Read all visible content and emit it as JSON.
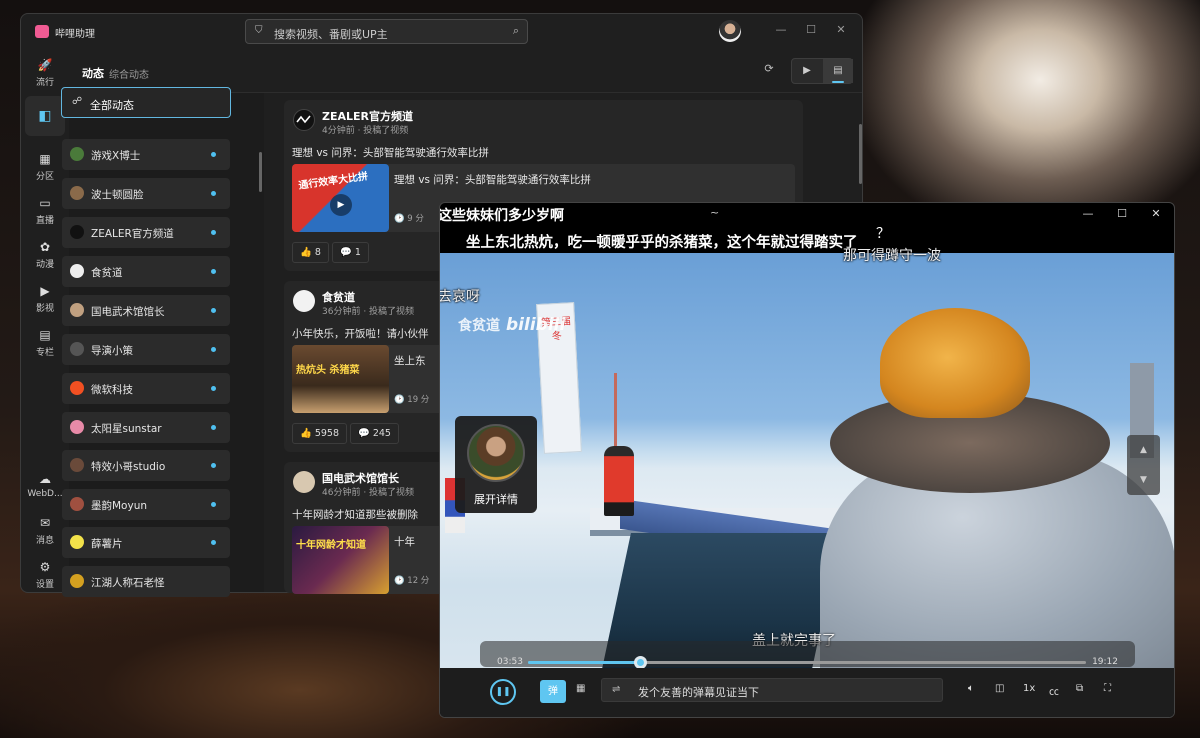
{
  "app": {
    "title": "哔哩助理"
  },
  "search": {
    "placeholder": "搜索视频、番剧或UP主"
  },
  "window_controls": {
    "minimize": "—",
    "maximize": "☐",
    "close": "✕"
  },
  "rail": [
    {
      "label": "流行",
      "icon": "rocket-icon",
      "glyph": "🚀"
    },
    {
      "label": "",
      "icon": "dynamic-icon",
      "glyph": "◧"
    },
    {
      "label": "分区",
      "icon": "grid-icon",
      "glyph": "▦"
    },
    {
      "label": "直播",
      "icon": "camera-icon",
      "glyph": "▭"
    },
    {
      "label": "动漫",
      "icon": "anime-icon",
      "glyph": "✿"
    },
    {
      "label": "影视",
      "icon": "film-icon",
      "glyph": "▶"
    },
    {
      "label": "专栏",
      "icon": "article-icon",
      "glyph": "▤"
    },
    {
      "label": "WebD...",
      "icon": "cloud-icon",
      "glyph": "☁"
    },
    {
      "label": "消息",
      "icon": "mail-icon",
      "glyph": "✉"
    },
    {
      "label": "设置",
      "icon": "gear-icon",
      "glyph": "⚙"
    }
  ],
  "header": {
    "title": "动态",
    "subtitle": "综合动态"
  },
  "user_list": {
    "all": "全部动态",
    "items": [
      {
        "name": "游戏X博士",
        "color": "#4a7a3a"
      },
      {
        "name": "波士顿圆脸",
        "color": "#8a6a4a"
      },
      {
        "name": "ZEALER官方频道",
        "color": "#111111"
      },
      {
        "name": "食贫道",
        "color": "#eeeeee"
      },
      {
        "name": "国电武术馆馆长",
        "color": "#c0a080"
      },
      {
        "name": "导演小策",
        "color": "#555555"
      },
      {
        "name": "微软科技",
        "color": "#f25022"
      },
      {
        "name": "太阳星sunstar",
        "color": "#e88aa8"
      },
      {
        "name": "特效小哥studio",
        "color": "#6a4a3a"
      },
      {
        "name": "墨韵Moyun",
        "color": "#a05040"
      },
      {
        "name": "薛薯片",
        "color": "#f3e24a"
      },
      {
        "name": "江湖人称石老怪",
        "color": "#d4a020"
      }
    ]
  },
  "feed": [
    {
      "author": "ZEALER官方频道",
      "meta": "4分钟前 · 投稿了视频",
      "text": "理想 vs 问界：头部智能驾驶通行效率比拼",
      "video_title": "理想 vs 问界：头部智能驾驶通行效率比拼",
      "video_info": "🕑 9 分",
      "likes": "👍 8",
      "comments": "💬 1",
      "thumb_text": "通行效率大比拼"
    },
    {
      "author": "食贫道",
      "meta": "36分钟前 · 投稿了视频",
      "text": "小年快乐，开饭啦！请小伙伴",
      "video_title": "坐上东",
      "video_info": "🕑 19 分",
      "likes": "👍 5958",
      "comments": "💬 245",
      "thumb_text": "热炕头 杀猪菜"
    },
    {
      "author": "国电武术馆馆长",
      "meta": "46分钟前 · 投稿了视频",
      "text": "十年网龄才知道那些被删除",
      "video_title": "十年",
      "video_info": "🕑 12 分",
      "thumb_text": "十年网龄才知道"
    }
  ],
  "player": {
    "title_bar": "~",
    "video_title": "坐上东北热炕，吃一顿暖乎乎的杀猪菜，这个年就过得踏实了",
    "watermark_left": "食贫道",
    "watermark_right": "bilibili",
    "danmaku": [
      "这些妹妹们多少岁啊",
      "？",
      "那可得蹲守一波",
      "去哀呀",
      "盖上就完事了"
    ],
    "current_time": "03:53",
    "total_time": "19:12",
    "progress": 0.2,
    "danmaku_toggle": "弹",
    "danmaku_placeholder": "发个友善的弹幕见证当下",
    "speed": "1x",
    "float_label": "展开详情",
    "banner_text": "第三届冬"
  },
  "colors": {
    "accent": "#5fc6f1",
    "bg": "#1f1f1f"
  }
}
